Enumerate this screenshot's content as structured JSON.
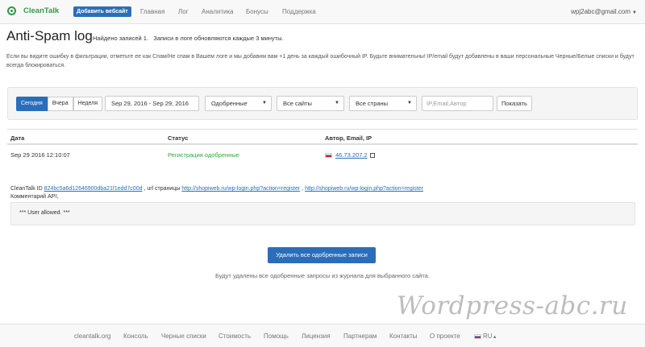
{
  "nav": {
    "logo": "CleanTalk",
    "add_site": "Добавить вебсайт",
    "links": [
      "Главная",
      "Лог",
      "Аналитика",
      "Бонусы",
      "Поддержка"
    ],
    "user_email": "wpj2abc@gmail.com"
  },
  "header": {
    "title": "Anti-Spam log",
    "found": "Найдено записей 1.",
    "update_note": "Записи в логе обновляются каждые 3 минуты.",
    "info": "Если вы видите ошибку в фильтрации, отметьте ее как Спам/Не спам в Вашем логе и мы добавим вам +1 день за каждый ошибочный IP. Будьте внимательны! IP/email будут добавлены в ваши персональные Черные/Белые списки и будут всегда блокироваться."
  },
  "filters": {
    "period_buttons": [
      "Сегодня",
      "Вчера",
      "Неделя"
    ],
    "date_range": "Sep 29, 2016 - Sep 29, 2016",
    "status_select": "Одобренные",
    "sites_select": "Все сайты",
    "countries_select": "Все страны",
    "search_placeholder": "IP,Email,Автор",
    "show_button": "Показать"
  },
  "table": {
    "headers": [
      "Дата",
      "Статус",
      "Автор, Email, IP"
    ],
    "rows": [
      {
        "date": "Sep 29 2016 12:10:07",
        "status": "Регистрация одобренные",
        "ip": "46.73.207.2"
      }
    ]
  },
  "details": {
    "cleantalk_id_label": "CleanTalk ID",
    "cleantalk_id": "824bc5a6d12646900dba21f1edd7c00d",
    "url_label": ", url страницы",
    "url1": "http://shopiweb.ru/wp-login.php?action=register",
    "url2": "http://shopiweb.ru/wp-login.php?action=register",
    "comment_label": "Комментарий API,",
    "log_text": "*** User allowed. ***"
  },
  "actions": {
    "delete_button": "Удалить все одобренные записи",
    "delete_note": "Будут удалены все одобренные запросы из журнала для выбранного сайта."
  },
  "watermark": "Wordpress-abc.ru",
  "footer": {
    "links": [
      "cleantalk.org",
      "Консоль",
      "Черные списки",
      "Стоимость",
      "Помощь",
      "Лицензия",
      "Партнерам",
      "Контакты",
      "О проекте"
    ],
    "language": "RU"
  },
  "colors": {
    "primary": "#2a6ebb",
    "success": "#3aa43a",
    "brand": "#2f9a48"
  }
}
